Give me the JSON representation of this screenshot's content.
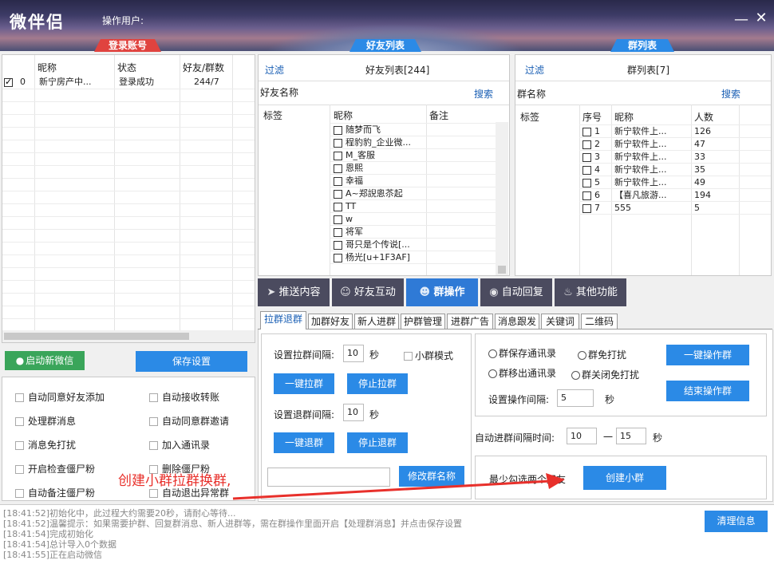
{
  "app": {
    "title": "微伴侣",
    "operator_label": "操作用户:"
  },
  "window": {
    "minimize": "—",
    "close": "✕"
  },
  "sections": {
    "login": "登录账号",
    "friends": "好友列表",
    "groups": "群列表"
  },
  "accounts": {
    "columns": [
      "昵称",
      "状态",
      "好友/群数"
    ],
    "rows": [
      {
        "idx": "0",
        "checked": true,
        "name": "新宁房产中...",
        "status": "登录成功",
        "count": "244/7"
      }
    ]
  },
  "friends_panel": {
    "filter": "过滤",
    "title": "好友列表[244]",
    "name_label": "好友名称",
    "search": "搜索",
    "columns": [
      "标签",
      "昵称",
      "备注"
    ],
    "rows": [
      "随梦而飞",
      "程豹豹_企业微...",
      "M_客服",
      "恩熙",
      "幸福",
      "A~郑誽恖苶起",
      "TT",
      "w",
      "将军",
      "哥只是个传说[...",
      "杨光[u+1F3AF]"
    ]
  },
  "groups_panel": {
    "filter": "过滤",
    "title": "群列表[7]",
    "name_label": "群名称",
    "search": "搜索",
    "columns": [
      "标签",
      "序号",
      "昵称",
      "人数"
    ],
    "rows": [
      {
        "no": "1",
        "name": "新宁软件上...",
        "count": "126"
      },
      {
        "no": "2",
        "name": "新宁软件上...",
        "count": "47"
      },
      {
        "no": "3",
        "name": "新宁软件上...",
        "count": "33"
      },
      {
        "no": "4",
        "name": "新宁软件上...",
        "count": "35"
      },
      {
        "no": "5",
        "name": "新宁软件上...",
        "count": "49"
      },
      {
        "no": "6",
        "name": "【喜凡旅游...",
        "count": "194"
      },
      {
        "no": "7",
        "name": "555",
        "count": "5"
      }
    ]
  },
  "left_actions": {
    "start_wechat": "启动新微信",
    "save_settings": "保存设置"
  },
  "options": [
    "自动同意好友添加",
    "自动接收转账",
    "处理群消息",
    "自动同意群邀请",
    "消息免打扰",
    "加入通讯录",
    "开启检查僵尸粉",
    "删除僵尸粉",
    "自动备注僵尸粉",
    "自动退出异常群"
  ],
  "nav": [
    "推送内容",
    "好友互动",
    "群操作",
    "自动回复",
    "其他功能"
  ],
  "subtabs": [
    "拉群退群",
    "加群好友",
    "新人进群",
    "护群管理",
    "进群广告",
    "消息跟发",
    "关键词",
    "二维码"
  ],
  "pull": {
    "interval_label": "设置拉群间隔:",
    "interval_value": "10",
    "sec": "秒",
    "small_mode": "小群模式",
    "one_click_pull": "一键拉群",
    "stop_pull": "停止拉群",
    "quit_interval_label": "设置退群间隔:",
    "quit_interval_value": "10",
    "one_click_quit": "一键退群",
    "stop_quit": "停止退群",
    "rename_btn": "修改群名称",
    "rename_value": ""
  },
  "group_ops": {
    "radios": [
      "群保存通讯录",
      "群免打扰",
      "群移出通讯录",
      "群关闭免打扰"
    ],
    "one_click_op": "一键操作群",
    "end_op": "结束操作群",
    "op_interval_label": "设置操作间隔:",
    "op_interval_value": "5",
    "sec": "秒",
    "auto_join_label": "自动进群间隔时间:",
    "join_from": "10",
    "dash": "一",
    "join_to": "15",
    "join_sec": "秒",
    "min_hint": "最少勾选两个好友",
    "create_small": "创建小群"
  },
  "annotation": "创建小群拉群换群,",
  "log": {
    "clear_btn": "清理信息",
    "lines": [
      "[18:41:52]初始化中，此过程大约需要20秒，请耐心等待...",
      "[18:41:52]温馨提示：如果需要护群、回复群消息、新人进群等，需在群操作里面开启【处理群消息】并点击保存设置",
      "[18:41:54]完成初始化",
      "[18:41:54]总计导入0个数据",
      "[18:41:55]正在启动微信"
    ]
  },
  "colors": {
    "accent": "#2b8ae6",
    "tab_red": "#e0433f",
    "tab_blue": "#2b8ae6",
    "annotation": "#e8302b"
  }
}
